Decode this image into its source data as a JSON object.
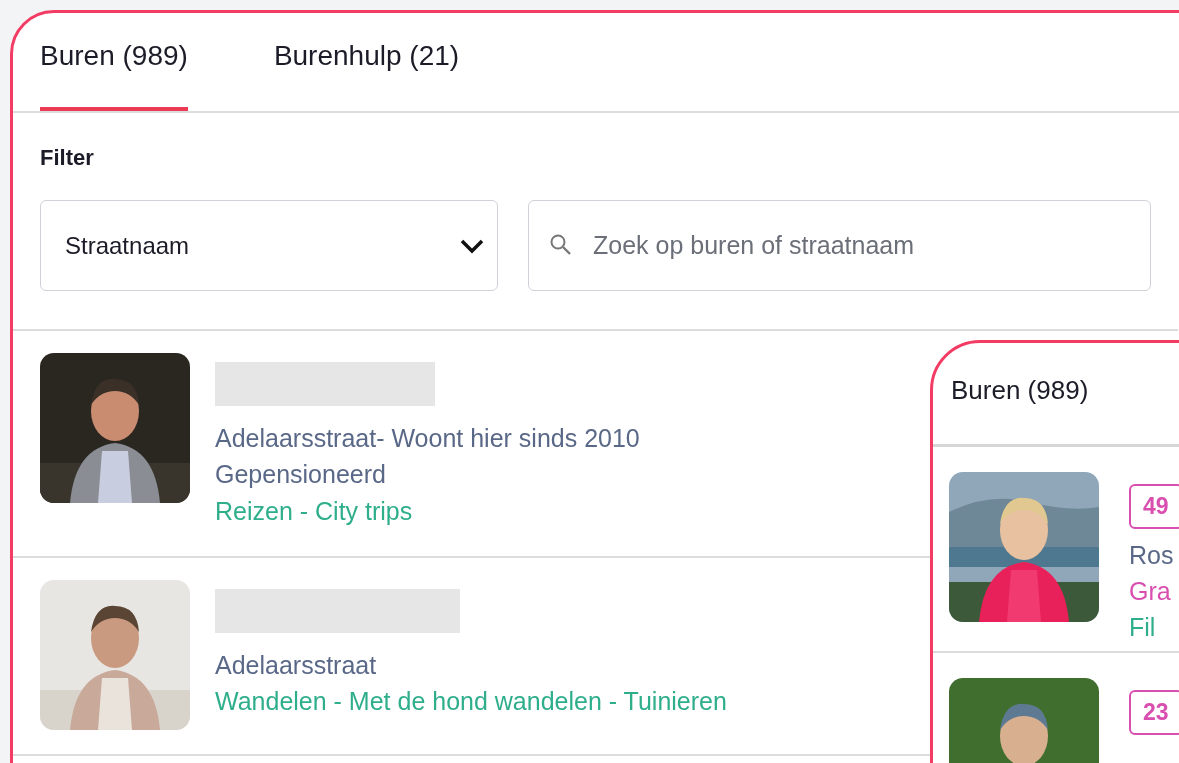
{
  "tabs": [
    {
      "label": "Buren (989)",
      "selected": true
    },
    {
      "label": "Burenhulp (21)",
      "selected": false
    }
  ],
  "filter": {
    "label": "Filter",
    "street_select": {
      "value": "Straatnaam"
    },
    "search": {
      "placeholder": "Zoek op buren of straatnaam"
    }
  },
  "neighbours": [
    {
      "address": "Adelaarsstraat- Woont hier sinds 2010",
      "occupation": "Gepensioneerd",
      "interests": "Reizen - City trips"
    },
    {
      "address": "Adelaarsstraat",
      "interests": "Wandelen - Met de hond wandelen - Tuinieren"
    }
  ],
  "overlay": {
    "title": "Buren (989)",
    "neighbours": [
      {
        "age": "49",
        "address": "Ros",
        "occupation": "Gra",
        "interests": "Fil"
      },
      {
        "age": "23"
      }
    ]
  }
}
